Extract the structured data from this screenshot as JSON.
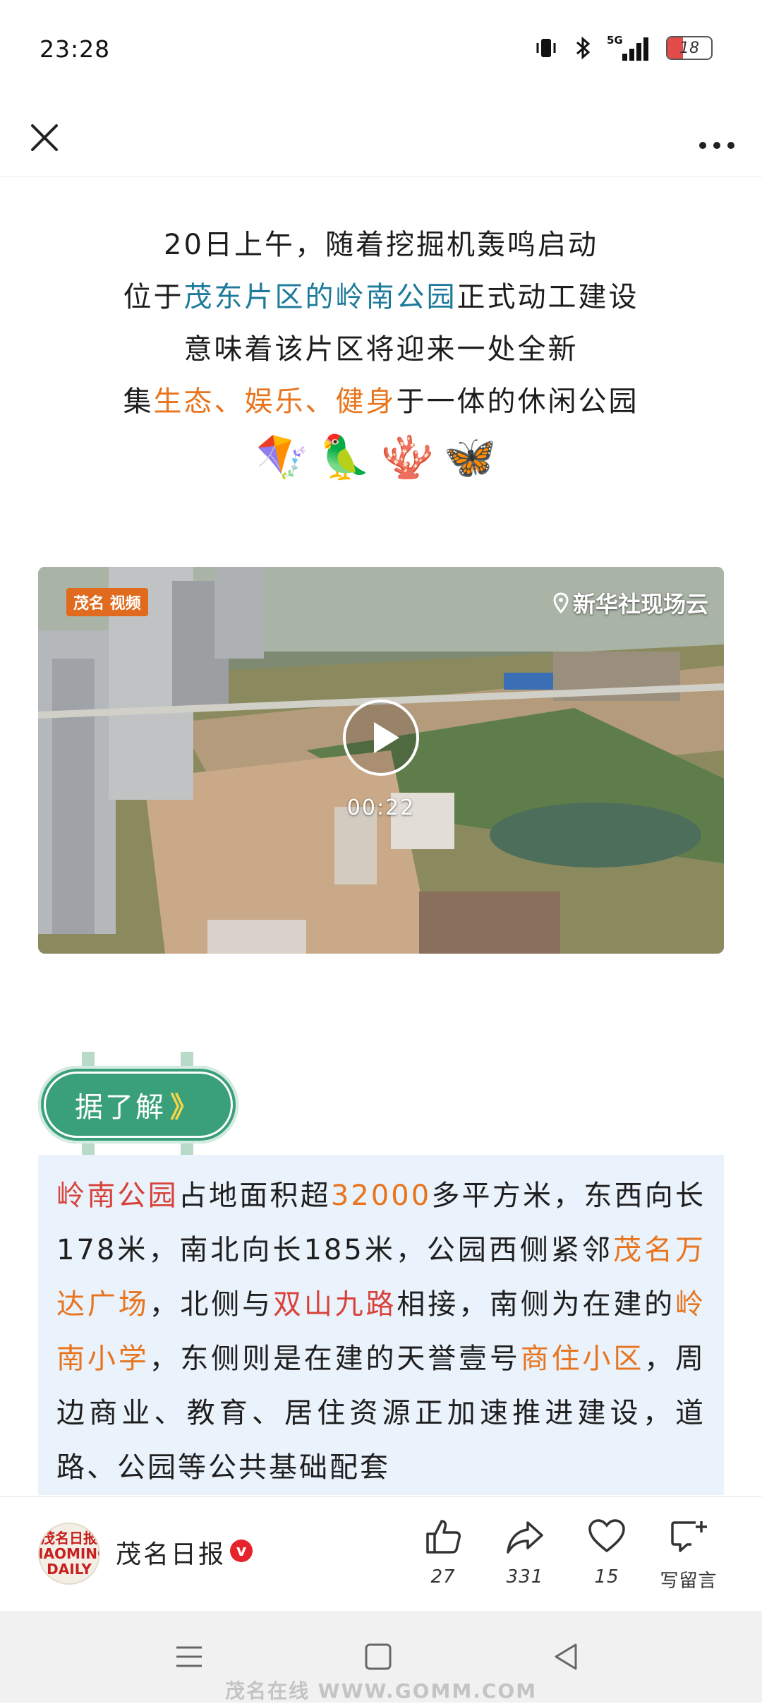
{
  "status_bar": {
    "time": "23:28",
    "network": "5G",
    "battery": "18",
    "icons": [
      "vibrate-icon",
      "bluetooth-icon",
      "signal-icon",
      "battery-icon"
    ]
  },
  "topbar": {
    "icons": [
      "close-icon",
      "more-icon"
    ]
  },
  "intro": {
    "line1": "20日上午，随着挖掘机轰鸣启动",
    "line2_pre": "位于",
    "line2_hl": "茂东片区的岭南公园",
    "line2_post": "正式动工建设",
    "line3": "意味着该片区将迎来一处全新",
    "line4_pre": "集",
    "line4_hl": "生态、娱乐、健身",
    "line4_post": "于一体的休闲公园",
    "emojis": "🪁🦜🪸🦋"
  },
  "video": {
    "logo_text": "茂名 视频",
    "watermark": "新华社现场云",
    "duration": "00:22"
  },
  "section_tag": {
    "label": "据了解",
    "arrows": "》"
  },
  "body": {
    "s1": "岭南公园",
    "s2": "占地面积超",
    "s3": "32000",
    "s4": "多平方米，东西向长178米，南北向长185米，公园西侧紧邻",
    "s5": "茂名万达广场",
    "s6": "，北侧与",
    "s7": "双山九路",
    "s8": "相接，南侧为在建的",
    "s9": "岭南小学",
    "s10": "，东侧则是在建的天誉壹号",
    "s11": "商住小区",
    "s12": "，周边商业、教育、居住资源正加速推进建设，道路、公园等公共基础配套"
  },
  "account": {
    "avatar_text": "茂名日报 MAOMING DAILY",
    "name": "茂名日报",
    "verified": "v"
  },
  "actions": {
    "like_count": "27",
    "share_count": "331",
    "fav_count": "15",
    "comment_label": "写留言"
  },
  "watermark": "茂名在线 WWW.GOMM.COM",
  "colors": {
    "accent_orange": "#e8741e",
    "accent_blue": "#1e7a9a",
    "tag_green": "#3aa07a",
    "body_bg": "#eaf2fb"
  }
}
